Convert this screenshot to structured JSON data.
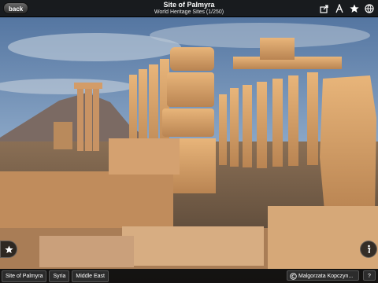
{
  "topbar": {
    "back_label": "back",
    "title": "Site of Palmyra",
    "subtitle": "World Heritage Sites (1/250)"
  },
  "icons": {
    "share": "share-icon",
    "font": "font-size-icon",
    "favorite": "star-icon",
    "globe": "globe-icon",
    "favorite_float": "star-icon",
    "info": "info-icon",
    "copyright": "copyright-icon"
  },
  "bottombar": {
    "tags": [
      "Site of Palmyra",
      "Syria",
      "Middle East"
    ],
    "credit": "Malgorzata Kopczyn...",
    "help_label": "?"
  },
  "colors": {
    "sky_top": "#5d7ea8",
    "stone": "#d9a56a",
    "bar_background": "#141414"
  }
}
